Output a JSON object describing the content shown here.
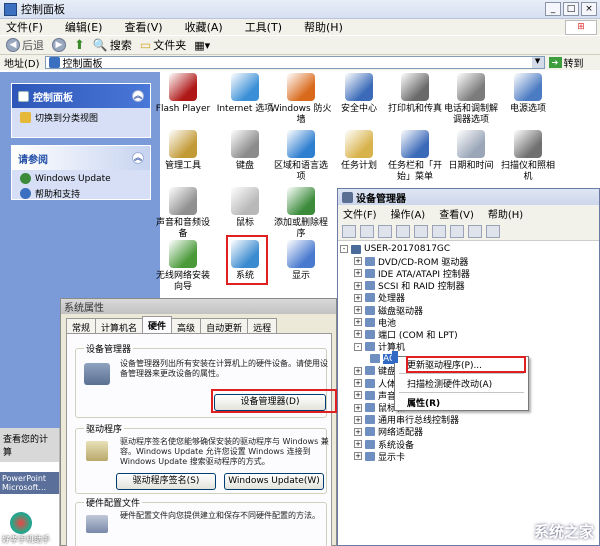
{
  "window": {
    "title": "控制面板",
    "close": "×",
    "min": "_",
    "max": "□"
  },
  "menu": [
    "文件(F)",
    "编辑(E)",
    "查看(V)",
    "收藏(A)",
    "工具(T)",
    "帮助(H)"
  ],
  "toolbar": {
    "back": "后退",
    "search": "搜索",
    "folders": "文件夹"
  },
  "address": {
    "label": "地址(D)",
    "value": "控制面板",
    "go": "转到"
  },
  "left": {
    "panel_title": "控制面板",
    "switch_link": "切换到分类视图",
    "see_also_title": "请参阅",
    "see_also": [
      "Windows Update",
      "帮助和支持"
    ],
    "strip_title": "查看您的计算",
    "strip_items": [
      "PowerPoint",
      "Microsoft...",
      "好孝手机助手"
    ]
  },
  "icons": [
    {
      "label": "Flash Player",
      "color": "#b01818"
    },
    {
      "label": "Internet 选项",
      "color": "#3a8fd6"
    },
    {
      "label": "Windows 防火墙",
      "color": "#d96a1c"
    },
    {
      "label": "安全中心",
      "color": "#3a6ab8"
    },
    {
      "label": "打印机和传真",
      "color": "#6a6a6a"
    },
    {
      "label": "电话和调制解调器选项",
      "color": "#7b7b7b"
    },
    {
      "label": "电源选项",
      "color": "#4b7bc2"
    },
    {
      "label": "管理工具",
      "color": "#c29a36"
    },
    {
      "label": "键盘",
      "color": "#8b8b8b"
    },
    {
      "label": "区域和语言选项",
      "color": "#2f7fd0"
    },
    {
      "label": "任务计划",
      "color": "#d8b24a"
    },
    {
      "label": "任务栏和「开始」菜单",
      "color": "#3b6ab8"
    },
    {
      "label": "日期和时间",
      "color": "#9aa6b8"
    },
    {
      "label": "扫描仪和照相机",
      "color": "#707070"
    },
    {
      "label": "声音和音频设备",
      "color": "#909090"
    },
    {
      "label": "鼠标",
      "color": "#b8b8b8"
    },
    {
      "label": "添加或删除程序",
      "color": "#3b8b3b"
    },
    {
      "label": "无线网络安装向导",
      "color": "#4a9a3a"
    },
    {
      "label": "系统",
      "color": "#3b8bd0"
    },
    {
      "label": "显示",
      "color": "#4a7ad0"
    }
  ],
  "dm": {
    "title": "设备管理器",
    "menu": [
      "文件(F)",
      "操作(A)",
      "查看(V)",
      "帮助(H)"
    ],
    "tree": [
      {
        "label": "USER-20170817GC",
        "exp": "-"
      },
      {
        "label": "DVD/CD-ROM 驱动器",
        "exp": "+"
      },
      {
        "label": "IDE ATA/ATAPI 控制器",
        "exp": "+"
      },
      {
        "label": "SCSI 和 RAID 控制器",
        "exp": "+"
      },
      {
        "label": "处理器",
        "exp": "+"
      },
      {
        "label": "磁盘驱动器",
        "exp": "+"
      },
      {
        "label": "电池",
        "exp": "+"
      },
      {
        "label": "端口 (COM 和 LPT)",
        "exp": "+"
      },
      {
        "label": "计算机",
        "exp": "-"
      },
      {
        "label": "AC",
        "exp": ""
      },
      {
        "label": "键盘",
        "exp": "+"
      },
      {
        "label": "人体学",
        "exp": "+"
      },
      {
        "label": "声音、",
        "exp": "+"
      },
      {
        "label": "鼠标和",
        "exp": "+"
      },
      {
        "label": "通用串行总线控制器",
        "exp": "+"
      },
      {
        "label": "网络适配器",
        "exp": "+"
      },
      {
        "label": "系统设备",
        "exp": "+"
      },
      {
        "label": "显示卡",
        "exp": "+"
      }
    ],
    "context": {
      "update": "更新驱动程序(P)...",
      "scan": "扫描检测硬件改动(A)",
      "props": "属性(R)"
    }
  },
  "sp": {
    "title": "系统属性",
    "tabs": [
      "常规",
      "计算机名",
      "硬件",
      "高级",
      "自动更新",
      "远程"
    ],
    "dm_group": "设备管理器",
    "dm_text": "设备管理器列出所有安装在计算机上的硬件设备。请使用设备管理器来更改设备的属性。",
    "dm_button": "设备管理器(D)",
    "drv_group": "驱动程序",
    "drv_text": "驱动程序签名使您能够确保安装的驱动程序与 Windows 兼容。Windows Update 允许您设置 Windows 连接到 Windows Update 搜索驱动程序的方式。",
    "drv_sign": "驱动程序签名(S)",
    "drv_update": "Windows Update(W)",
    "hw_group": "硬件配置文件",
    "hw_text": "硬件配置文件向您提供建立和保存不同硬件配置的方法。"
  },
  "watermark": "系统之家"
}
